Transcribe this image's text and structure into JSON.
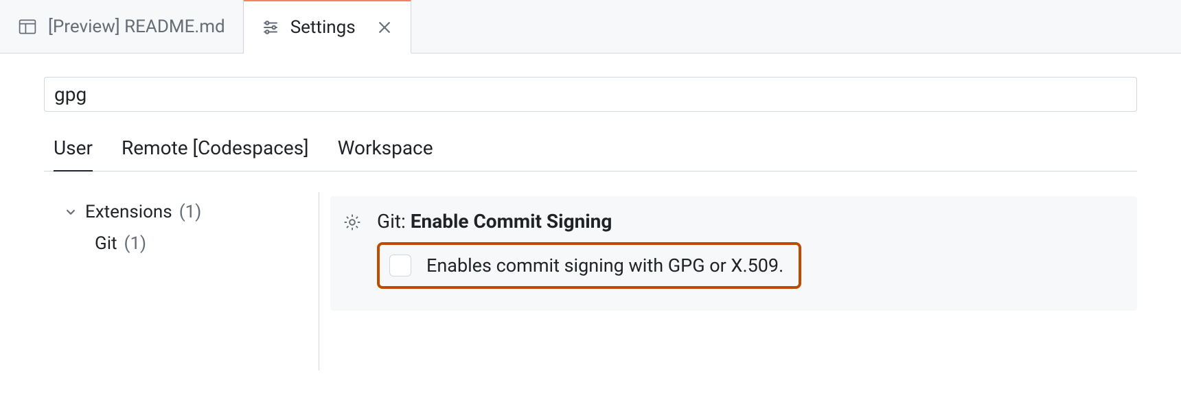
{
  "tabs": [
    {
      "label": "[Preview] README.md",
      "active": false
    },
    {
      "label": "Settings",
      "active": true
    }
  ],
  "search": {
    "value": "gpg"
  },
  "scopes": [
    {
      "label": "User",
      "active": true
    },
    {
      "label": "Remote [Codespaces]",
      "active": false
    },
    {
      "label": "Workspace",
      "active": false
    }
  ],
  "sidebar": {
    "category": {
      "label": "Extensions",
      "count": "(1)"
    },
    "child": {
      "label": "Git",
      "count": "(1)"
    }
  },
  "setting": {
    "prefix": "Git: ",
    "name": "Enable Commit Signing",
    "description": "Enables commit signing with GPG or X.509.",
    "checked": false
  }
}
